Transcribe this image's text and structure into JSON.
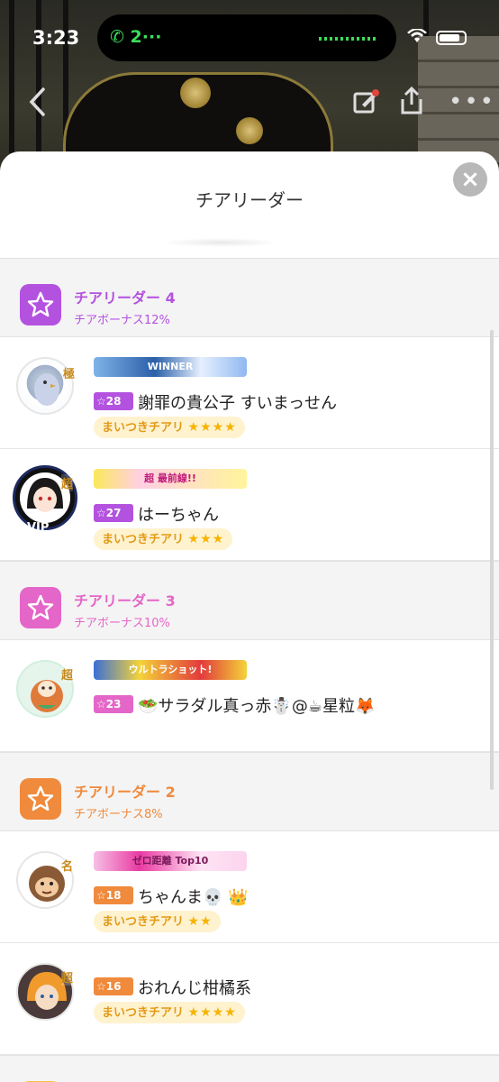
{
  "status": {
    "time": "3:23",
    "call_indicator": "2",
    "call_dots": "···"
  },
  "sheet": {
    "title": "チアリーダー",
    "close_icon": "×"
  },
  "colors": {
    "tier4": "#b452e0",
    "tier3": "#e466c8",
    "tier2": "#f08a3c",
    "level4": "#b452e0",
    "level3": "#e466c8",
    "level2": "#f08a3c"
  },
  "tiers": [
    {
      "name": "チアリーダー 4",
      "bonus": "チアボーナス12%",
      "members": [
        {
          "banner": "WINNER",
          "rank_mark": "極",
          "level_star": "☆",
          "level": "28",
          "name": "謝罪の貴公子 すいまっせん",
          "cheer_label": "まいつきチアリ",
          "cheer_stars": "★★★★",
          "avatar_icon": "bird-avatar-icon"
        },
        {
          "banner": "超 最前線!!",
          "rank_mark": "超",
          "level_star": "☆",
          "level": "27",
          "name": "はーちゃん",
          "cheer_label": "まいつきチアリ",
          "cheer_stars": "★★★",
          "avatar_icon": "girl-avatar-icon",
          "frame_text": "VIP"
        }
      ]
    },
    {
      "name": "チアリーダー 3",
      "bonus": "チアボーナス10%",
      "members": [
        {
          "banner": "ウルトラショット!",
          "rank_mark": "超",
          "level_star": "☆",
          "level": "23",
          "name": "🥗サラダル真っ赤☃️@☕星粒🦊",
          "avatar_icon": "daruma-avatar-icon"
        }
      ]
    },
    {
      "name": "チアリーダー 2",
      "bonus": "チアボーナス8%",
      "members": [
        {
          "banner": "ゼロ距離 Top10",
          "rank_mark": "名",
          "level_star": "☆",
          "level": "18",
          "name": "ちゃんま💀 👑",
          "cheer_label": "まいつきチアリ",
          "cheer_stars": "★★",
          "avatar_icon": "monkey-avatar-icon"
        },
        {
          "rank_mark": "超",
          "level_star": "☆",
          "level": "16",
          "name": "おれんじ柑橘系",
          "cheer_label": "まいつきチアリ",
          "cheer_stars": "★★★★",
          "avatar_icon": "orange-hair-avatar-icon"
        }
      ]
    }
  ]
}
